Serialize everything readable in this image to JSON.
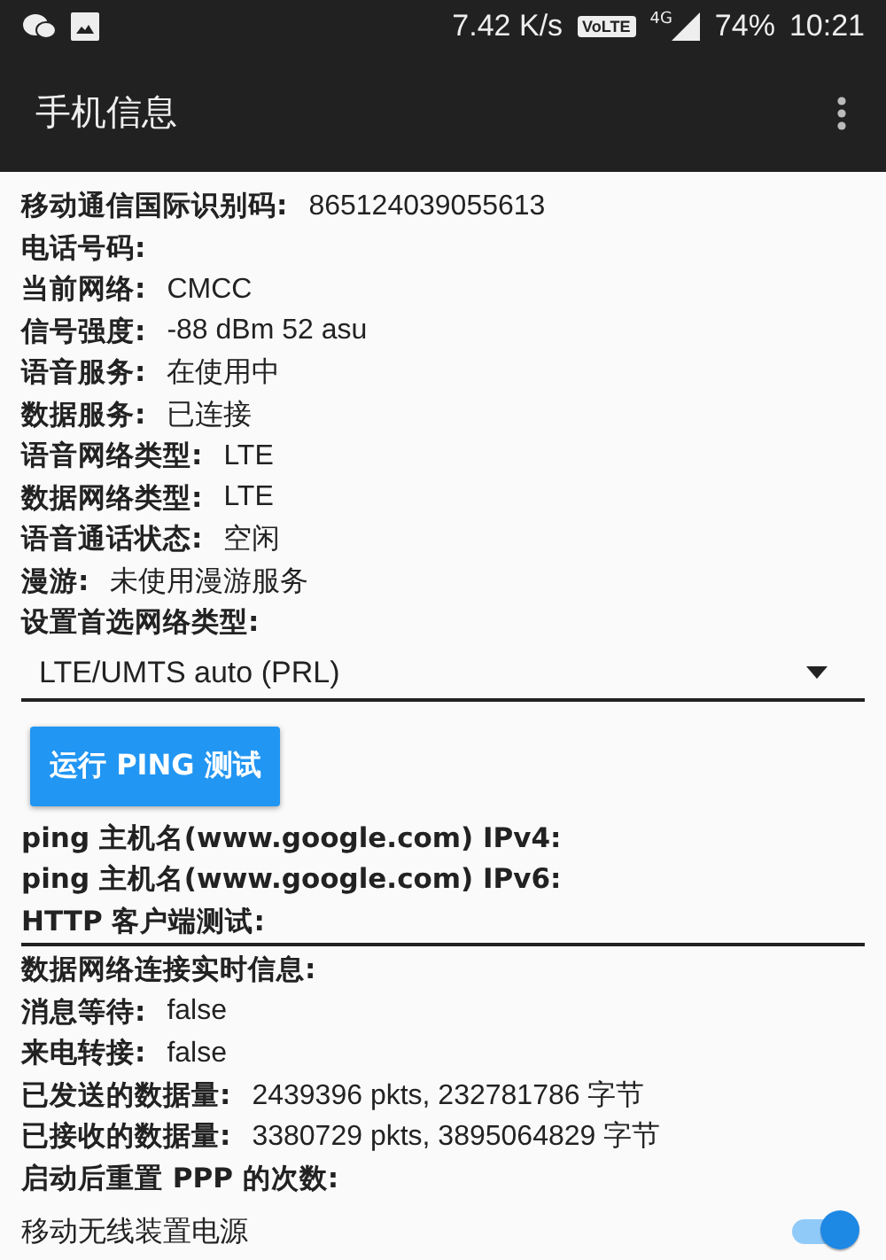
{
  "status_bar": {
    "speed": "7.42 K/s",
    "volte": "VoLTE",
    "network": "4G",
    "battery": "74%",
    "time": "10:21"
  },
  "app_bar": {
    "title": "手机信息"
  },
  "info_rows": [
    {
      "label": "移动通信国际识别码:",
      "value": "865124039055613"
    },
    {
      "label": "电话号码:",
      "value": ""
    },
    {
      "label": "当前网络:",
      "value": "CMCC"
    },
    {
      "label": "信号强度:",
      "value": "-88 dBm   52 asu"
    },
    {
      "label": "语音服务:",
      "value": "在使用中"
    },
    {
      "label": "数据服务:",
      "value": "已连接"
    },
    {
      "label": "语音网络类型:",
      "value": "LTE"
    },
    {
      "label": "数据网络类型:",
      "value": "LTE"
    },
    {
      "label": "语音通话状态:",
      "value": "空闲"
    },
    {
      "label": "漫游:",
      "value": "未使用漫游服务"
    },
    {
      "label": "设置首选网络类型:",
      "value": ""
    }
  ],
  "network_dropdown": {
    "value": "LTE/UMTS auto (PRL)"
  },
  "ping_button": "运行 PING 测试",
  "ping_rows": [
    {
      "label": "ping 主机名(www.google.com) IPv4:"
    },
    {
      "label": "ping 主机名(www.google.com) IPv6:"
    },
    {
      "label": "HTTP 客户端测试:"
    }
  ],
  "realtime_rows": [
    {
      "label": "数据网络连接实时信息:",
      "value": ""
    },
    {
      "label": "消息等待:",
      "value": "false"
    },
    {
      "label": "来电转接:",
      "value": "false"
    },
    {
      "label": "已发送的数据量:",
      "value": "2439396 pkts, 232781786 字节"
    },
    {
      "label": "已接收的数据量:",
      "value": "3380729 pkts, 3895064829 字节"
    },
    {
      "label": "启动后重置 PPP 的次数:",
      "value": ""
    }
  ],
  "radio_power": {
    "label": "移动无线装置电源",
    "on": true
  }
}
